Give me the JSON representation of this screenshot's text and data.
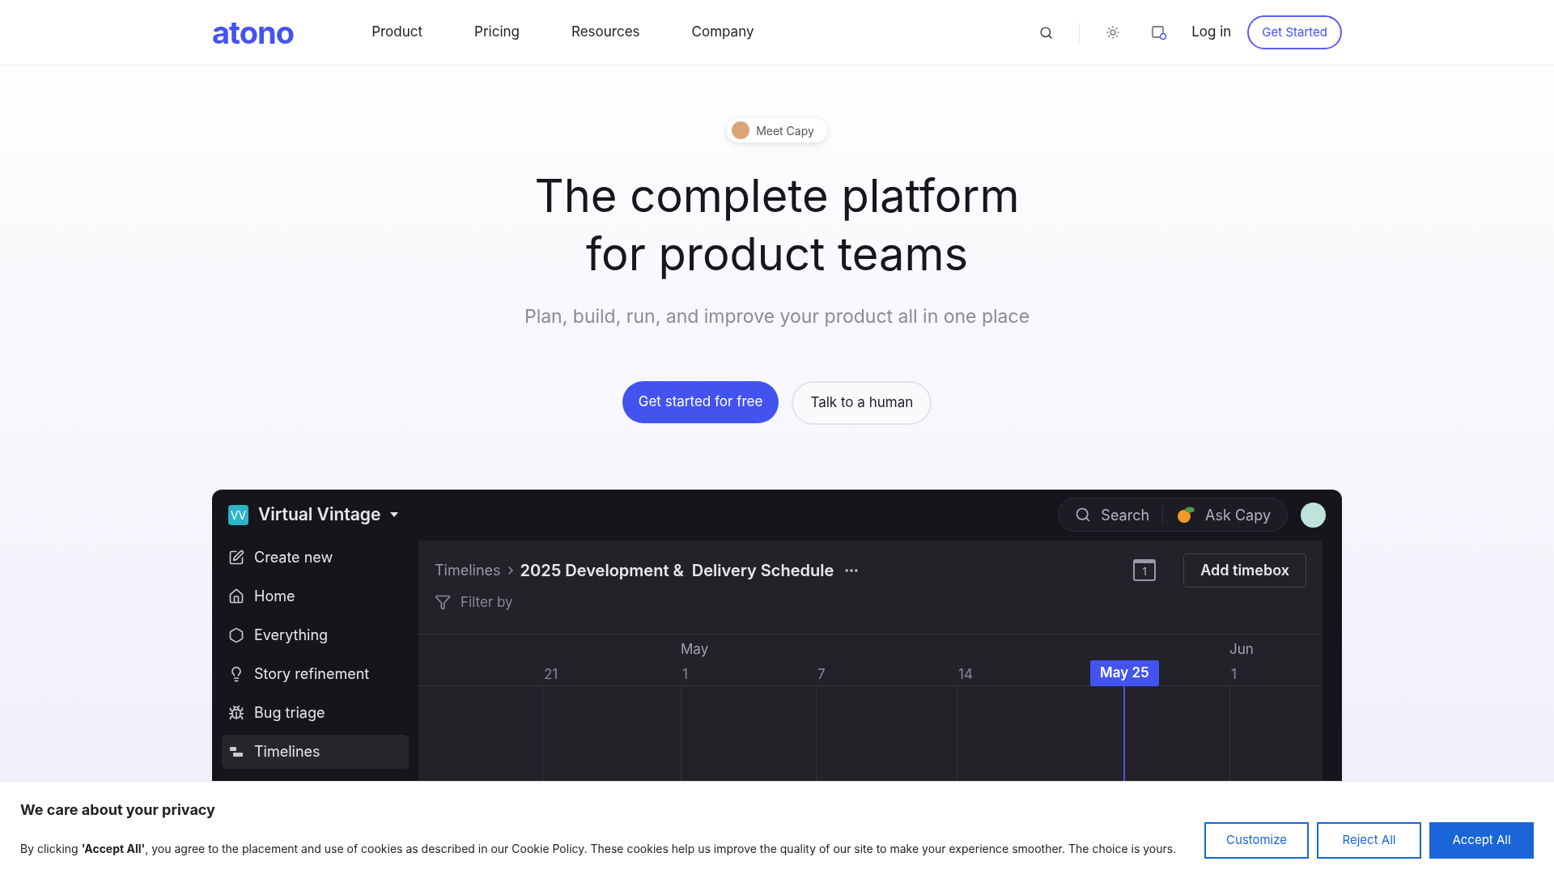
{
  "nav": {
    "logo": "atono",
    "links": [
      "Product",
      "Pricing",
      "Resources",
      "Company"
    ],
    "login": "Log in",
    "cta": "Get Started"
  },
  "hero": {
    "badge": "Meet Capy",
    "title_lines": [
      "The complete platform",
      "for product teams"
    ],
    "subtitle": "Plan, build, run, and improve your product all in one place",
    "primary": "Get started for free",
    "secondary": "Talk to a human"
  },
  "app": {
    "workspace": {
      "initials": "VV",
      "name": "Virtual Vintage"
    },
    "search": "Search",
    "ask": "Ask Capy",
    "sidebar": [
      {
        "label": "Create new",
        "kind": "create",
        "selected": false
      },
      {
        "label": "Home",
        "kind": "home",
        "selected": false
      },
      {
        "label": "Everything",
        "kind": "everything",
        "selected": false
      },
      {
        "label": "Story refinement",
        "kind": "refinement",
        "selected": false
      },
      {
        "label": "Bug triage",
        "kind": "triage",
        "selected": false
      },
      {
        "label": "Timelines",
        "kind": "timelines",
        "selected": true
      }
    ],
    "breadcrumb": "Timelines",
    "page_title": "2025 Development &  Delivery Schedule",
    "filter": "Filter by",
    "calendar_day": "1",
    "add": "Add timebox",
    "months": [
      "May",
      "Jun"
    ],
    "ticks": [
      {
        "label": "21",
        "kind": "date"
      },
      {
        "label": "1",
        "kind": "date"
      },
      {
        "label": "7",
        "kind": "date"
      },
      {
        "label": "14",
        "kind": "date"
      },
      {
        "label": "May 25",
        "kind": "today"
      },
      {
        "label": "1",
        "kind": "date"
      }
    ]
  },
  "cookie": {
    "title": "We care about your privacy",
    "text": "By clicking **'Accept All'**, you agree to the placement and use of cookies as described in our Cookie Policy. These cookies help us improve the quality of our site to make your experience smoother. The choice is yours.",
    "buttons": [
      "Customize",
      "Reject All",
      "Accept All"
    ]
  }
}
